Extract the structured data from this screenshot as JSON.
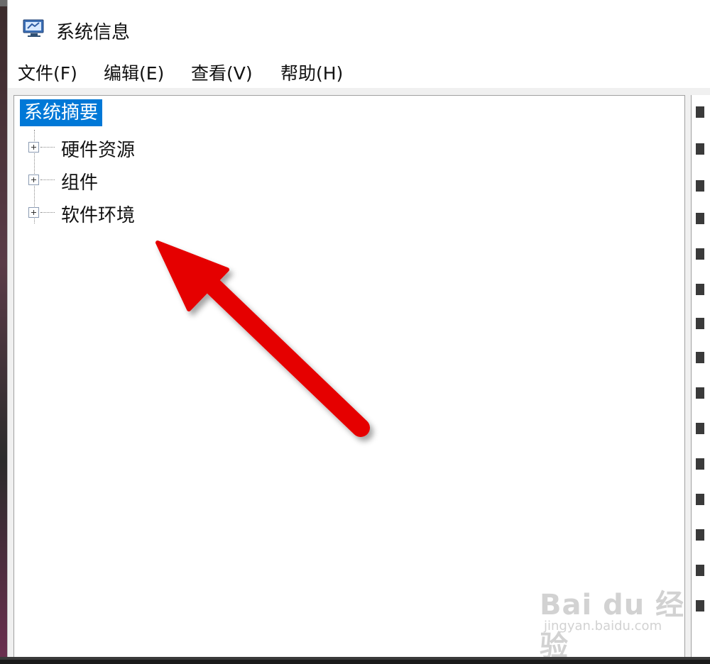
{
  "window": {
    "title": "系统信息",
    "icon": "system-info-icon"
  },
  "menubar": {
    "file": "文件(F)",
    "edit": "编辑(E)",
    "view": "查看(V)",
    "help": "帮助(H)"
  },
  "tree": {
    "root_label": "系统摘要",
    "items": [
      {
        "label": "硬件资源"
      },
      {
        "label": "组件"
      },
      {
        "label": "软件环境"
      }
    ]
  },
  "annotation": {
    "arrow_color": "#e50000"
  },
  "watermark": {
    "main": "Bai du 经验",
    "sub": "jingyan.baidu.com"
  },
  "colors": {
    "selection": "#0078d7"
  }
}
